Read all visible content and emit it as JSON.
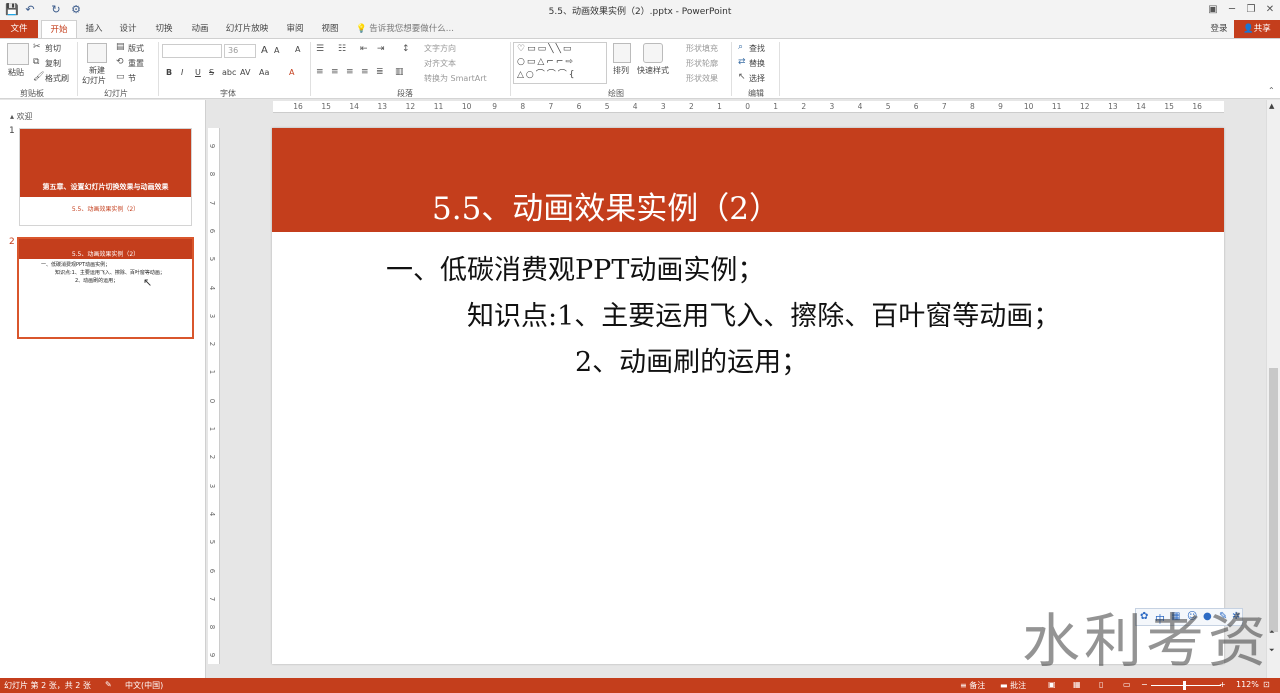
{
  "window": {
    "title": "5.5、动画效果实例（2）.pptx - PowerPoint",
    "minimize": "─",
    "restore": "❐",
    "close": "✕"
  },
  "qat": {
    "save": "💾",
    "undo": "↶",
    "redo": "↻",
    "custom": "⚙"
  },
  "tabs": [
    {
      "label": "文件"
    },
    {
      "label": "开始"
    },
    {
      "label": "插入"
    },
    {
      "label": "设计"
    },
    {
      "label": "切换"
    },
    {
      "label": "动画"
    },
    {
      "label": "幻灯片放映"
    },
    {
      "label": "审阅"
    },
    {
      "label": "视图"
    }
  ],
  "tell_me": "告诉我您想要做什么...",
  "account": {
    "login": "登录",
    "share": "共享"
  },
  "ribbon": {
    "clipboard": {
      "paste": "粘贴",
      "cut": "剪切",
      "copy": "复制",
      "format_painter": "格式刷",
      "label": "剪贴板"
    },
    "slides": {
      "new_slide": "新建",
      "new_slide2": "幻灯片",
      "layout": "版式",
      "reset": "重置",
      "section": "节",
      "label": "幻灯片"
    },
    "font": {
      "font_size": "36",
      "bold": "B",
      "italic": "I",
      "underline": "U",
      "strike": "S",
      "shadow": "abc",
      "spacing": "AV",
      "case": "Aa",
      "color": "A",
      "grow": "A",
      "shrink": "A",
      "clear": "A",
      "label": "字体"
    },
    "paragraph": {
      "text_direction": "文字方向",
      "align_text": "对齐文本",
      "smartart": "转换为 SmartArt",
      "label": "段落"
    },
    "drawing": {
      "arrange": "排列",
      "quick_styles": "快速样式",
      "shape_fill": "形状填充",
      "shape_outline": "形状轮廓",
      "shape_effects": "形状效果",
      "label": "绘图"
    },
    "editing": {
      "find": "查找",
      "replace": "替换",
      "select": "选择",
      "label": "编辑"
    }
  },
  "slide_panel": {
    "section": "欢迎",
    "slides": [
      {
        "num": "1",
        "title": "第五章、设置幻灯片切换效果与动画效果",
        "subtitle": "5.5、动画效果实例（2）"
      },
      {
        "num": "2",
        "title": "5.5、动画效果实例（2）",
        "lines": [
          "一、低碳消费观PPT动画实例；",
          "知识点:1、主要运用飞入、擦除、百叶窗等动画；",
          "2、动画刷的运用；"
        ]
      }
    ]
  },
  "slide": {
    "title": "5.5、动画效果实例（2）",
    "lines": [
      "一、低碳消费观PPT动画实例；",
      "知识点:1、主要运用飞入、擦除、百叶窗等动画；",
      "2、动画刷的运用；"
    ]
  },
  "ruler": {
    "h_ticks": [
      "16",
      "15",
      "14",
      "13",
      "12",
      "11",
      "10",
      "9",
      "8",
      "7",
      "6",
      "5",
      "4",
      "3",
      "2",
      "1",
      "0",
      "1",
      "2",
      "3",
      "4",
      "5",
      "6",
      "7",
      "8",
      "9",
      "10",
      "11",
      "12",
      "13",
      "14",
      "15",
      "16"
    ],
    "v_ticks": [
      "9",
      "8",
      "7",
      "6",
      "5",
      "4",
      "3",
      "2",
      "1",
      "0",
      "1",
      "2",
      "3",
      "4",
      "5",
      "6",
      "7",
      "8",
      "9"
    ]
  },
  "status": {
    "slide_info": "幻灯片 第 2 张，共 2 张",
    "language": "中文(中国)",
    "notes": "备注",
    "comments": "批注",
    "zoom": "112%"
  },
  "ime": {
    "mode": "中"
  },
  "watermark": "水利考资",
  "colors": {
    "accent": "#c43e1c",
    "ribbon_bg": "#ffffff",
    "canvas_bg": "#e6e6e6"
  }
}
